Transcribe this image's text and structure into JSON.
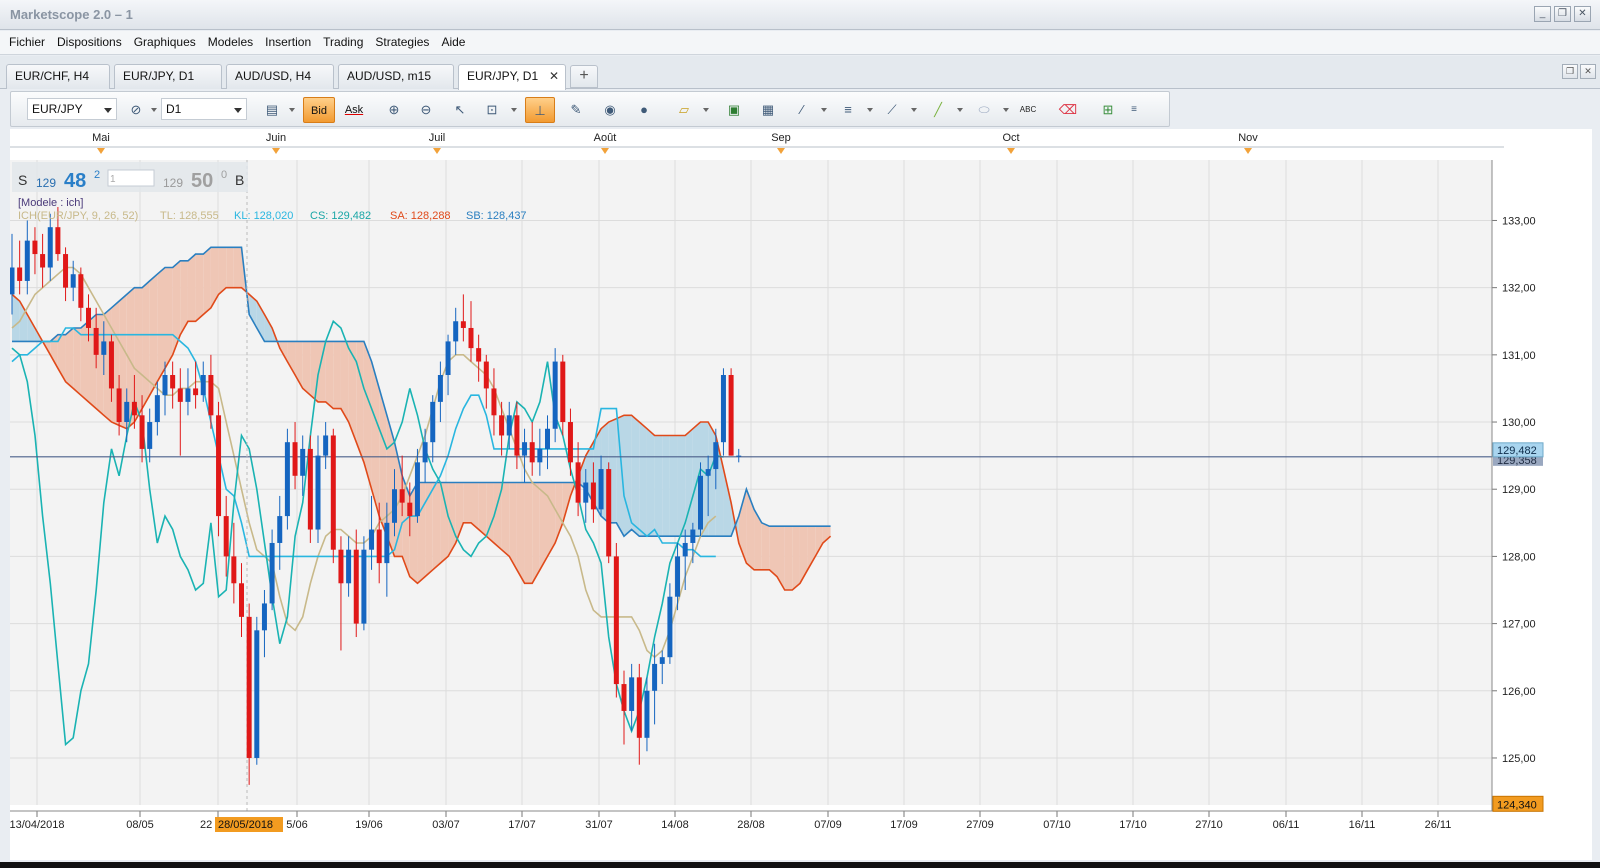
{
  "window": {
    "title": "Marketscope 2.0 – 1",
    "minimize": "_",
    "restore": "❐",
    "close": "✕"
  },
  "menu": [
    "Fichier",
    "Dispositions",
    "Graphiques",
    "Modeles",
    "Insertion",
    "Trading",
    "Strategies",
    "Aide"
  ],
  "tabs": [
    {
      "label": "EUR/CHF, H4",
      "active": false
    },
    {
      "label": "EUR/JPY, D1",
      "active": false
    },
    {
      "label": "AUD/USD, H4",
      "active": false
    },
    {
      "label": "AUD/USD, m15",
      "active": false
    },
    {
      "label": "EUR/JPY, D1",
      "active": true
    }
  ],
  "tab_close": "✕",
  "tab_add": "+",
  "toolbar": {
    "symbol": "EUR/JPY",
    "timeframe": "D1",
    "bid_label": "Bid",
    "ask_label": "Ask",
    "text_tool": "ABC"
  },
  "chart": {
    "month_labels": [
      "Mai",
      "Juin",
      "Juil",
      "Août",
      "Sep",
      "Oct",
      "Nov"
    ],
    "date_labels": [
      "13/04/2018",
      "08/05",
      "22",
      "5/06",
      "19/06",
      "03/07",
      "17/07",
      "31/07",
      "14/08",
      "28/08",
      "07/09",
      "17/09",
      "27/09",
      "07/10",
      "17/10",
      "27/10",
      "06/11",
      "16/11",
      "26/11"
    ],
    "cursor_date": "28/05/2018",
    "price_labels": [
      "133,00",
      "132,00",
      "131,00",
      "130,00",
      "129,00",
      "128,00",
      "127,00",
      "126,00",
      "125,00"
    ],
    "current_price_tag": "129,482",
    "current_price_tag_hidden": "129,358",
    "cursor_price_tag": "124,340",
    "quote": {
      "sell_label": "S",
      "sell_big": "129",
      "sell_pips": "48",
      "sell_frac": "2",
      "amount": "1",
      "buy_big": "129",
      "buy_pips": "50",
      "buy_frac": "0",
      "buy_label": "B"
    },
    "template_label": "[Modele : ich]",
    "indicator_label": "ICH(EUR/JPY, 9, 26, 52)",
    "indicator_values": [
      {
        "text": "TL: 128,555",
        "color": "#c8b98a"
      },
      {
        "text": "KL: 128,020",
        "color": "#29b6e0"
      },
      {
        "text": "CS: 129,482",
        "color": "#1aa6a6"
      },
      {
        "text": "SA: 128,288",
        "color": "#e04a1a"
      },
      {
        "text": "SB: 128,437",
        "color": "#2a7fc0"
      }
    ],
    "colors": {
      "up": "#1565c0",
      "down": "#e01818",
      "tenkan": "#c8b98a",
      "kijun": "#29b6e0",
      "chikou": "#1ab3b3",
      "spanA": "#e04a1a",
      "spanB": "#2a7fc0",
      "cloud_bull": "#b9d7e6",
      "cloud_bear": "#efc6b5"
    }
  },
  "chart_data": {
    "type": "candlestick",
    "title": "EUR/JPY, D1",
    "symbol": "EUR/JPY",
    "ylim": [
      124.3,
      133.9
    ],
    "candles": [
      [
        131.9,
        132.8,
        131.6,
        132.3
      ],
      [
        132.3,
        132.7,
        131.9,
        132.1
      ],
      [
        132.1,
        133.0,
        131.9,
        132.7
      ],
      [
        132.7,
        132.9,
        132.2,
        132.5
      ],
      [
        132.5,
        132.8,
        132.0,
        132.3
      ],
      [
        132.3,
        133.1,
        132.1,
        132.9
      ],
      [
        132.9,
        133.2,
        132.4,
        132.5
      ],
      [
        132.5,
        132.6,
        131.8,
        132.0
      ],
      [
        132.0,
        132.4,
        131.8,
        132.2
      ],
      [
        132.2,
        132.3,
        131.5,
        131.7
      ],
      [
        131.7,
        131.9,
        131.2,
        131.4
      ],
      [
        131.4,
        131.7,
        130.8,
        131.0
      ],
      [
        131.0,
        131.5,
        130.7,
        131.2
      ],
      [
        131.2,
        131.3,
        130.3,
        130.5
      ],
      [
        130.5,
        130.7,
        129.8,
        130.0
      ],
      [
        130.0,
        130.5,
        129.7,
        130.3
      ],
      [
        130.3,
        130.7,
        129.9,
        130.1
      ],
      [
        130.1,
        130.4,
        129.4,
        129.6
      ],
      [
        129.6,
        130.2,
        129.4,
        130.0
      ],
      [
        130.0,
        130.6,
        129.8,
        130.4
      ],
      [
        130.4,
        130.9,
        130.1,
        130.7
      ],
      [
        130.7,
        130.9,
        130.2,
        130.5
      ],
      [
        130.5,
        130.8,
        129.5,
        130.3
      ],
      [
        130.3,
        130.8,
        130.1,
        130.5
      ],
      [
        130.5,
        130.9,
        130.2,
        130.4
      ],
      [
        130.4,
        130.9,
        130.3,
        130.7
      ],
      [
        130.7,
        131.0,
        129.9,
        130.1
      ],
      [
        130.1,
        130.3,
        128.3,
        128.6
      ],
      [
        128.6,
        128.9,
        127.7,
        128.0
      ],
      [
        128.0,
        128.5,
        127.3,
        127.6
      ],
      [
        127.6,
        127.9,
        126.8,
        127.1
      ],
      [
        127.1,
        127.3,
        124.6,
        125.0
      ],
      [
        125.0,
        127.1,
        124.9,
        126.9
      ],
      [
        126.9,
        127.5,
        126.5,
        127.3
      ],
      [
        127.3,
        128.4,
        127.2,
        128.2
      ],
      [
        128.2,
        128.9,
        127.8,
        128.6
      ],
      [
        128.6,
        129.9,
        128.4,
        129.7
      ],
      [
        129.7,
        130.0,
        129.0,
        129.2
      ],
      [
        129.2,
        129.8,
        128.9,
        129.6
      ],
      [
        129.6,
        129.8,
        128.2,
        128.4
      ],
      [
        128.4,
        129.8,
        128.2,
        129.5
      ],
      [
        129.5,
        130.0,
        129.3,
        129.8
      ],
      [
        129.8,
        129.9,
        127.9,
        128.1
      ],
      [
        128.1,
        128.3,
        126.6,
        127.6
      ],
      [
        127.6,
        128.3,
        127.4,
        128.1
      ],
      [
        128.1,
        128.4,
        126.8,
        127.0
      ],
      [
        127.0,
        128.3,
        126.9,
        128.1
      ],
      [
        128.1,
        128.9,
        127.8,
        128.4
      ],
      [
        128.4,
        128.8,
        127.6,
        127.9
      ],
      [
        127.9,
        128.8,
        127.4,
        128.5
      ],
      [
        128.5,
        129.3,
        128.3,
        129.0
      ],
      [
        129.0,
        129.5,
        128.6,
        128.8
      ],
      [
        128.8,
        129.1,
        128.3,
        128.6
      ],
      [
        128.6,
        129.6,
        128.5,
        129.4
      ],
      [
        129.4,
        129.9,
        129.1,
        129.7
      ],
      [
        129.7,
        130.4,
        129.4,
        130.3
      ],
      [
        130.3,
        130.9,
        130.0,
        130.7
      ],
      [
        130.7,
        131.3,
        130.4,
        131.2
      ],
      [
        131.2,
        131.7,
        131.0,
        131.5
      ],
      [
        131.5,
        131.9,
        131.2,
        131.4
      ],
      [
        131.4,
        131.8,
        130.9,
        131.1
      ],
      [
        131.1,
        131.3,
        130.6,
        130.9
      ],
      [
        130.9,
        131.0,
        130.2,
        130.5
      ],
      [
        130.5,
        130.8,
        129.8,
        130.1
      ],
      [
        130.1,
        130.3,
        129.5,
        129.8
      ],
      [
        129.8,
        130.3,
        129.6,
        130.1
      ],
      [
        130.1,
        130.3,
        129.3,
        129.5
      ],
      [
        129.5,
        129.9,
        129.1,
        129.7
      ],
      [
        129.7,
        130.0,
        129.2,
        129.4
      ],
      [
        129.4,
        129.9,
        129.2,
        129.6
      ],
      [
        129.6,
        130.1,
        129.3,
        129.9
      ],
      [
        129.9,
        131.1,
        129.7,
        130.9
      ],
      [
        130.9,
        131.0,
        129.8,
        130.0
      ],
      [
        130.0,
        130.2,
        129.2,
        129.4
      ],
      [
        129.4,
        129.7,
        128.6,
        128.8
      ],
      [
        128.8,
        129.3,
        128.5,
        129.1
      ],
      [
        129.1,
        129.4,
        128.5,
        128.7
      ],
      [
        128.7,
        129.5,
        128.6,
        129.3
      ],
      [
        129.3,
        129.4,
        127.9,
        128.0
      ],
      [
        128.0,
        128.2,
        125.9,
        126.1
      ],
      [
        126.1,
        126.3,
        125.2,
        125.7
      ],
      [
        125.7,
        126.4,
        125.4,
        126.2
      ],
      [
        126.2,
        126.4,
        124.9,
        125.3
      ],
      [
        125.3,
        126.2,
        125.1,
        126.0
      ],
      [
        126.0,
        126.7,
        125.5,
        126.4
      ],
      [
        126.4,
        126.6,
        126.1,
        126.5
      ],
      [
        126.5,
        127.6,
        126.4,
        127.4
      ],
      [
        127.4,
        128.2,
        127.2,
        128.0
      ],
      [
        128.0,
        128.4,
        127.5,
        128.2
      ],
      [
        128.2,
        128.5,
        127.9,
        128.4
      ],
      [
        128.4,
        129.4,
        128.3,
        129.2
      ],
      [
        129.2,
        129.5,
        128.6,
        129.3
      ],
      [
        129.3,
        129.9,
        129.0,
        129.7
      ],
      [
        129.7,
        130.8,
        129.5,
        130.7
      ],
      [
        130.7,
        130.8,
        129.5,
        129.5
      ],
      [
        129.5,
        129.6,
        129.4,
        129.5
      ]
    ],
    "series": [
      {
        "name": "TL",
        "last": 128.555
      },
      {
        "name": "KL",
        "last": 128.02
      },
      {
        "name": "CS",
        "last": 129.482
      },
      {
        "name": "SA",
        "last": 128.288
      },
      {
        "name": "SB",
        "last": 128.437
      }
    ],
    "current_price": 129.482,
    "crosshair_price": 124.34,
    "xlabel": "",
    "ylabel": ""
  }
}
